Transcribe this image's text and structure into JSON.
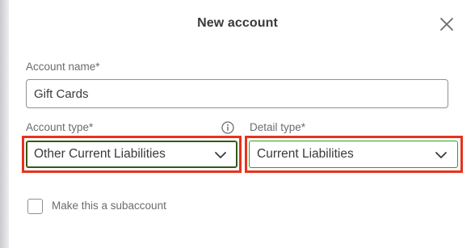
{
  "dialog": {
    "title": "New account",
    "close_icon": "close-icon"
  },
  "account_name": {
    "label": "Account name*",
    "value": "Gift Cards"
  },
  "account_type": {
    "label": "Account type*",
    "value": "Other Current Liabilities",
    "info_icon": "info-icon"
  },
  "detail_type": {
    "label": "Detail type*",
    "value": "Current Liabilities"
  },
  "subaccount": {
    "label": "Make this a subaccount",
    "checked": false
  },
  "colors": {
    "highlight": "#e8321e",
    "focus_border": "#2f5a16",
    "active_border": "#2ca01c",
    "text": "#393a3d",
    "label": "#6b6c72"
  }
}
